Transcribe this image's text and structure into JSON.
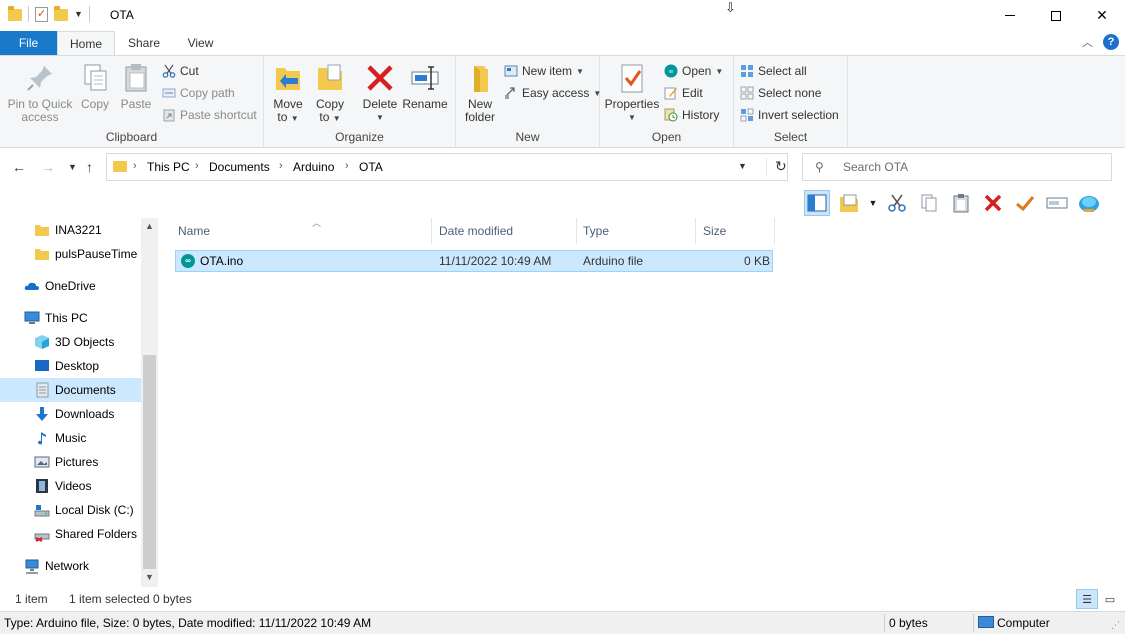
{
  "window": {
    "title": "OTA",
    "minimize_glyph": "",
    "maximize_glyph": "",
    "close_glyph": "✕"
  },
  "ribbon_tabs": {
    "file": "File",
    "home": "Home",
    "share": "Share",
    "view": "View",
    "help": "?"
  },
  "clipboard": {
    "label": "Clipboard",
    "pin_line1": "Pin to Quick",
    "pin_line2": "access",
    "copy": "Copy",
    "paste": "Paste",
    "cut": "Cut",
    "copy_path": "Copy path",
    "paste_shortcut": "Paste shortcut"
  },
  "organize": {
    "label": "Organize",
    "move_line1": "Move",
    "move_line2": "to",
    "copy_line1": "Copy",
    "copy_line2": "to",
    "delete": "Delete",
    "rename": "Rename"
  },
  "new_group": {
    "label": "New",
    "new_folder_line1": "New",
    "new_folder_line2": "folder",
    "new_item": "New item",
    "easy_access": "Easy access"
  },
  "open_group": {
    "label": "Open",
    "properties": "Properties",
    "open": "Open",
    "edit": "Edit",
    "history": "History"
  },
  "select_group": {
    "label": "Select",
    "select_all": "Select all",
    "select_none": "Select none",
    "invert_selection": "Invert selection"
  },
  "address": {
    "crumbs": [
      "This PC",
      "Documents",
      "Arduino",
      "OTA"
    ],
    "sep": "›"
  },
  "search": {
    "placeholder": "Search OTA"
  },
  "nav_pane": {
    "items": [
      {
        "label": "INA3221",
        "icon": "folder-icon"
      },
      {
        "label": "pulsPauseTime",
        "icon": "folder-icon"
      },
      {
        "label": "OneDrive",
        "icon": "cloud-icon"
      },
      {
        "label": "This PC",
        "icon": "computer-icon"
      },
      {
        "label": "3D Objects",
        "icon": "cube-icon"
      },
      {
        "label": "Desktop",
        "icon": "desktop-icon"
      },
      {
        "label": "Documents",
        "icon": "document-icon"
      },
      {
        "label": "Downloads",
        "icon": "download-icon"
      },
      {
        "label": "Music",
        "icon": "music-icon"
      },
      {
        "label": "Pictures",
        "icon": "pictures-icon"
      },
      {
        "label": "Videos",
        "icon": "video-icon"
      },
      {
        "label": "Local Disk (C:)",
        "icon": "drive-icon"
      },
      {
        "label": "Shared Folders (\\",
        "icon": "shared-drive-icon"
      },
      {
        "label": "Network",
        "icon": "network-icon"
      }
    ],
    "selected": "Documents"
  },
  "file_list": {
    "columns": [
      "Name",
      "Date modified",
      "Type",
      "Size"
    ],
    "rows": [
      {
        "name": "OTA.ino",
        "date": "11/11/2022 10:49 AM",
        "type": "Arduino file",
        "size": "0 KB"
      }
    ]
  },
  "status": {
    "item_count": "1 item",
    "selected": "1 item selected",
    "selected_size": "0 bytes"
  },
  "details": {
    "info": "Type: Arduino file, Size: 0 bytes, Date modified: 11/11/2022 10:49 AM",
    "size": "0 bytes",
    "location": "Computer"
  },
  "colors": {
    "accent": "#1979ca",
    "selection": "#cce8ff",
    "delete_red": "#d81e1e"
  }
}
